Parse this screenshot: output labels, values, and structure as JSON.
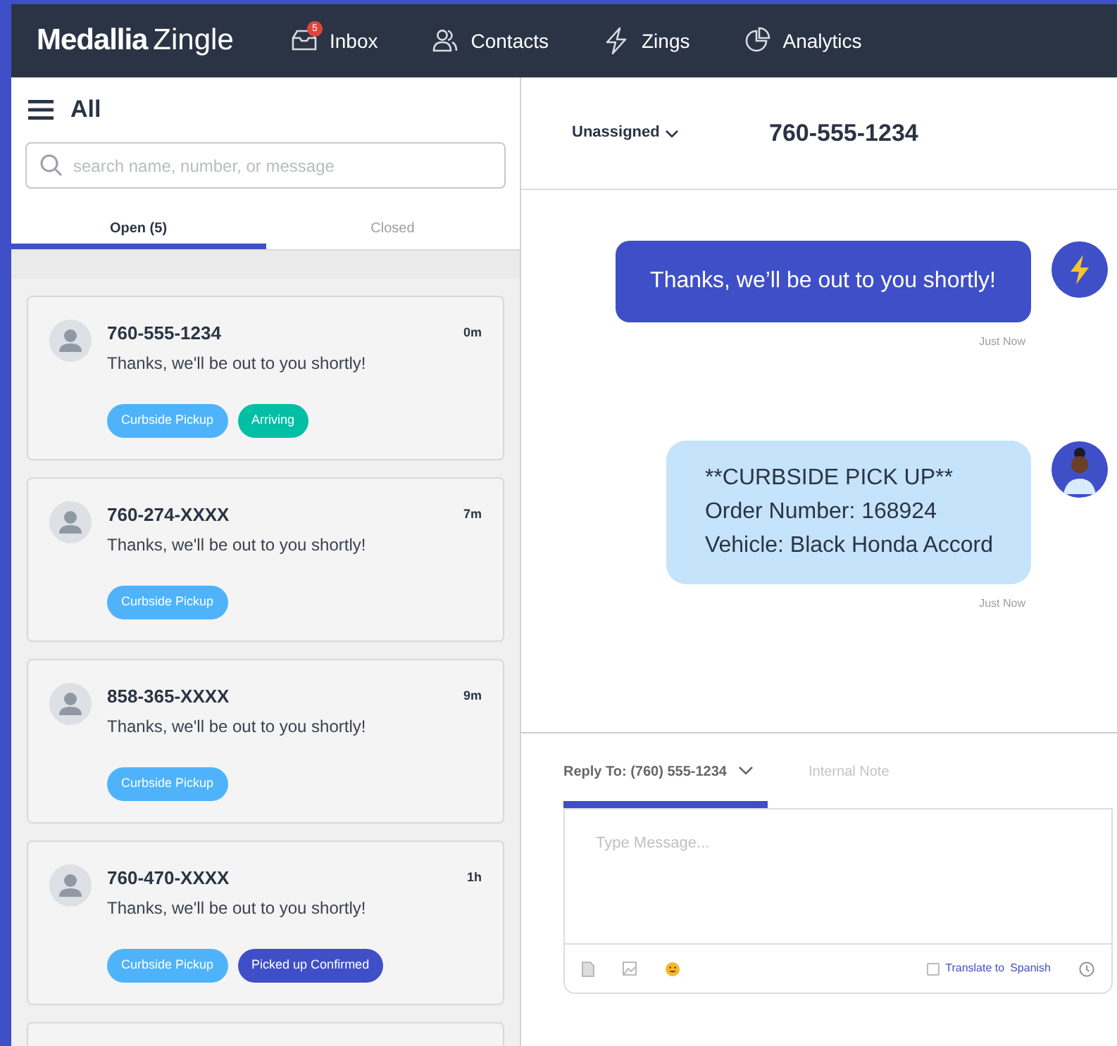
{
  "navbar": {
    "logo_bold": "Medallia",
    "logo_light": "Zingle",
    "items": [
      {
        "kind": "inbox",
        "label": "Inbox",
        "badge": "5"
      },
      {
        "kind": "contacts",
        "label": "Contacts"
      },
      {
        "kind": "zings",
        "label": "Zings"
      },
      {
        "kind": "analytics",
        "label": "Analytics"
      }
    ]
  },
  "sidebar": {
    "title": "All",
    "search": {
      "placeholder": "search name, number, or message"
    },
    "tabs": [
      {
        "label": "Open (5)",
        "selected": true
      },
      {
        "label": "Closed",
        "selected": false
      }
    ],
    "conversations": [
      {
        "phone": "760-555-1234",
        "time": "0m",
        "message": "Thanks, we'll be out to you shortly!",
        "tags": [
          {
            "label": "Curbside Pickup",
            "color": "#4fb3fb"
          },
          {
            "label": "Arriving",
            "color": "#00bfa5"
          }
        ]
      },
      {
        "phone": "760-274-XXXX",
        "time": "7m",
        "message": "Thanks, we'll be out to you shortly!",
        "tags": [
          {
            "label": "Curbside Pickup",
            "color": "#4fb3fb"
          }
        ]
      },
      {
        "phone": "858-365-XXXX",
        "time": "9m",
        "message": "Thanks, we'll be out to you shortly!",
        "tags": [
          {
            "label": "Curbside Pickup",
            "color": "#4fb3fb"
          }
        ]
      },
      {
        "phone": "760-470-XXXX",
        "time": "1h",
        "message": "Thanks, we'll be out to you shortly!",
        "tags": [
          {
            "label": "Curbside Pickup",
            "color": "#4fb3fb"
          },
          {
            "label": "Picked up Confirmed",
            "color": "#3f4fc7"
          }
        ]
      }
    ]
  },
  "conversation": {
    "assignee": "Unassigned",
    "phone": "760-555-1234",
    "messages": [
      {
        "kind": "automated",
        "lines": [
          "Thanks, we’ll be out to you shortly!"
        ],
        "time": "Just Now"
      },
      {
        "kind": "customer",
        "lines": [
          "**CURBSIDE PICK UP**",
          "Order Number: 168924",
          "Vehicle: Black Honda Accord"
        ],
        "time": "Just Now"
      }
    ],
    "compose": {
      "tabs": [
        {
          "label": "Reply To: (760) 555-1234",
          "selected": true
        },
        {
          "label": "Internal Note",
          "selected": false
        }
      ],
      "placeholder": "Type Message...",
      "translate": {
        "checked": false,
        "label": "Translate to",
        "language": "Spanish"
      }
    }
  }
}
